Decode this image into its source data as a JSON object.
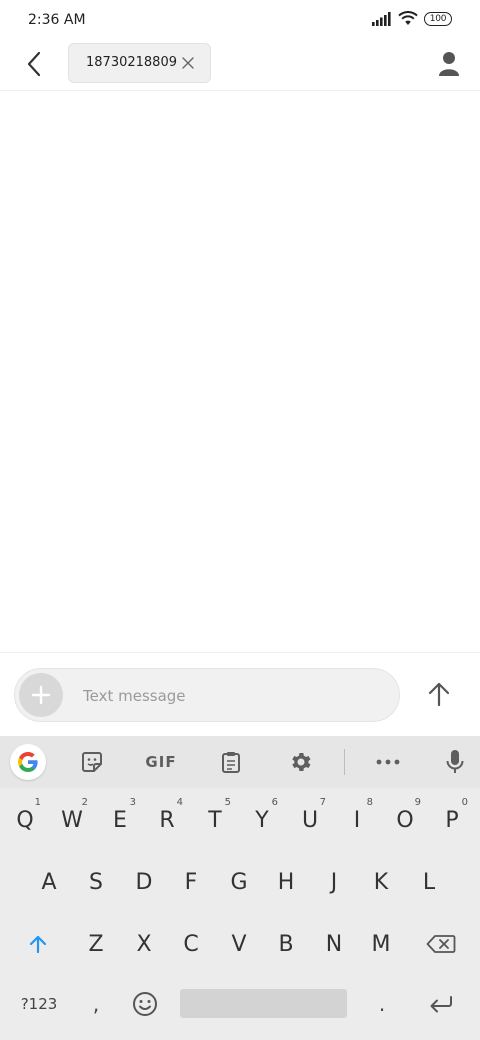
{
  "status_bar": {
    "time": "2:36 AM",
    "battery": "100"
  },
  "header": {
    "recipient": "18730218809"
  },
  "composer": {
    "placeholder": "Text message"
  },
  "keyboard": {
    "toolbar": {
      "gif_label": "GIF"
    },
    "row1": [
      {
        "label": "Q",
        "hint": "1"
      },
      {
        "label": "W",
        "hint": "2"
      },
      {
        "label": "E",
        "hint": "3"
      },
      {
        "label": "R",
        "hint": "4"
      },
      {
        "label": "T",
        "hint": "5"
      },
      {
        "label": "Y",
        "hint": "6"
      },
      {
        "label": "U",
        "hint": "7"
      },
      {
        "label": "I",
        "hint": "8"
      },
      {
        "label": "O",
        "hint": "9"
      },
      {
        "label": "P",
        "hint": "0"
      }
    ],
    "row2": [
      "A",
      "S",
      "D",
      "F",
      "G",
      "H",
      "J",
      "K",
      "L"
    ],
    "row3": [
      "Z",
      "X",
      "C",
      "V",
      "B",
      "N",
      "M"
    ],
    "symbols_label": "?123",
    "comma": ",",
    "period": "."
  },
  "colors": {
    "accent": "#1a73e8",
    "shift_blue": "#2196f3"
  }
}
